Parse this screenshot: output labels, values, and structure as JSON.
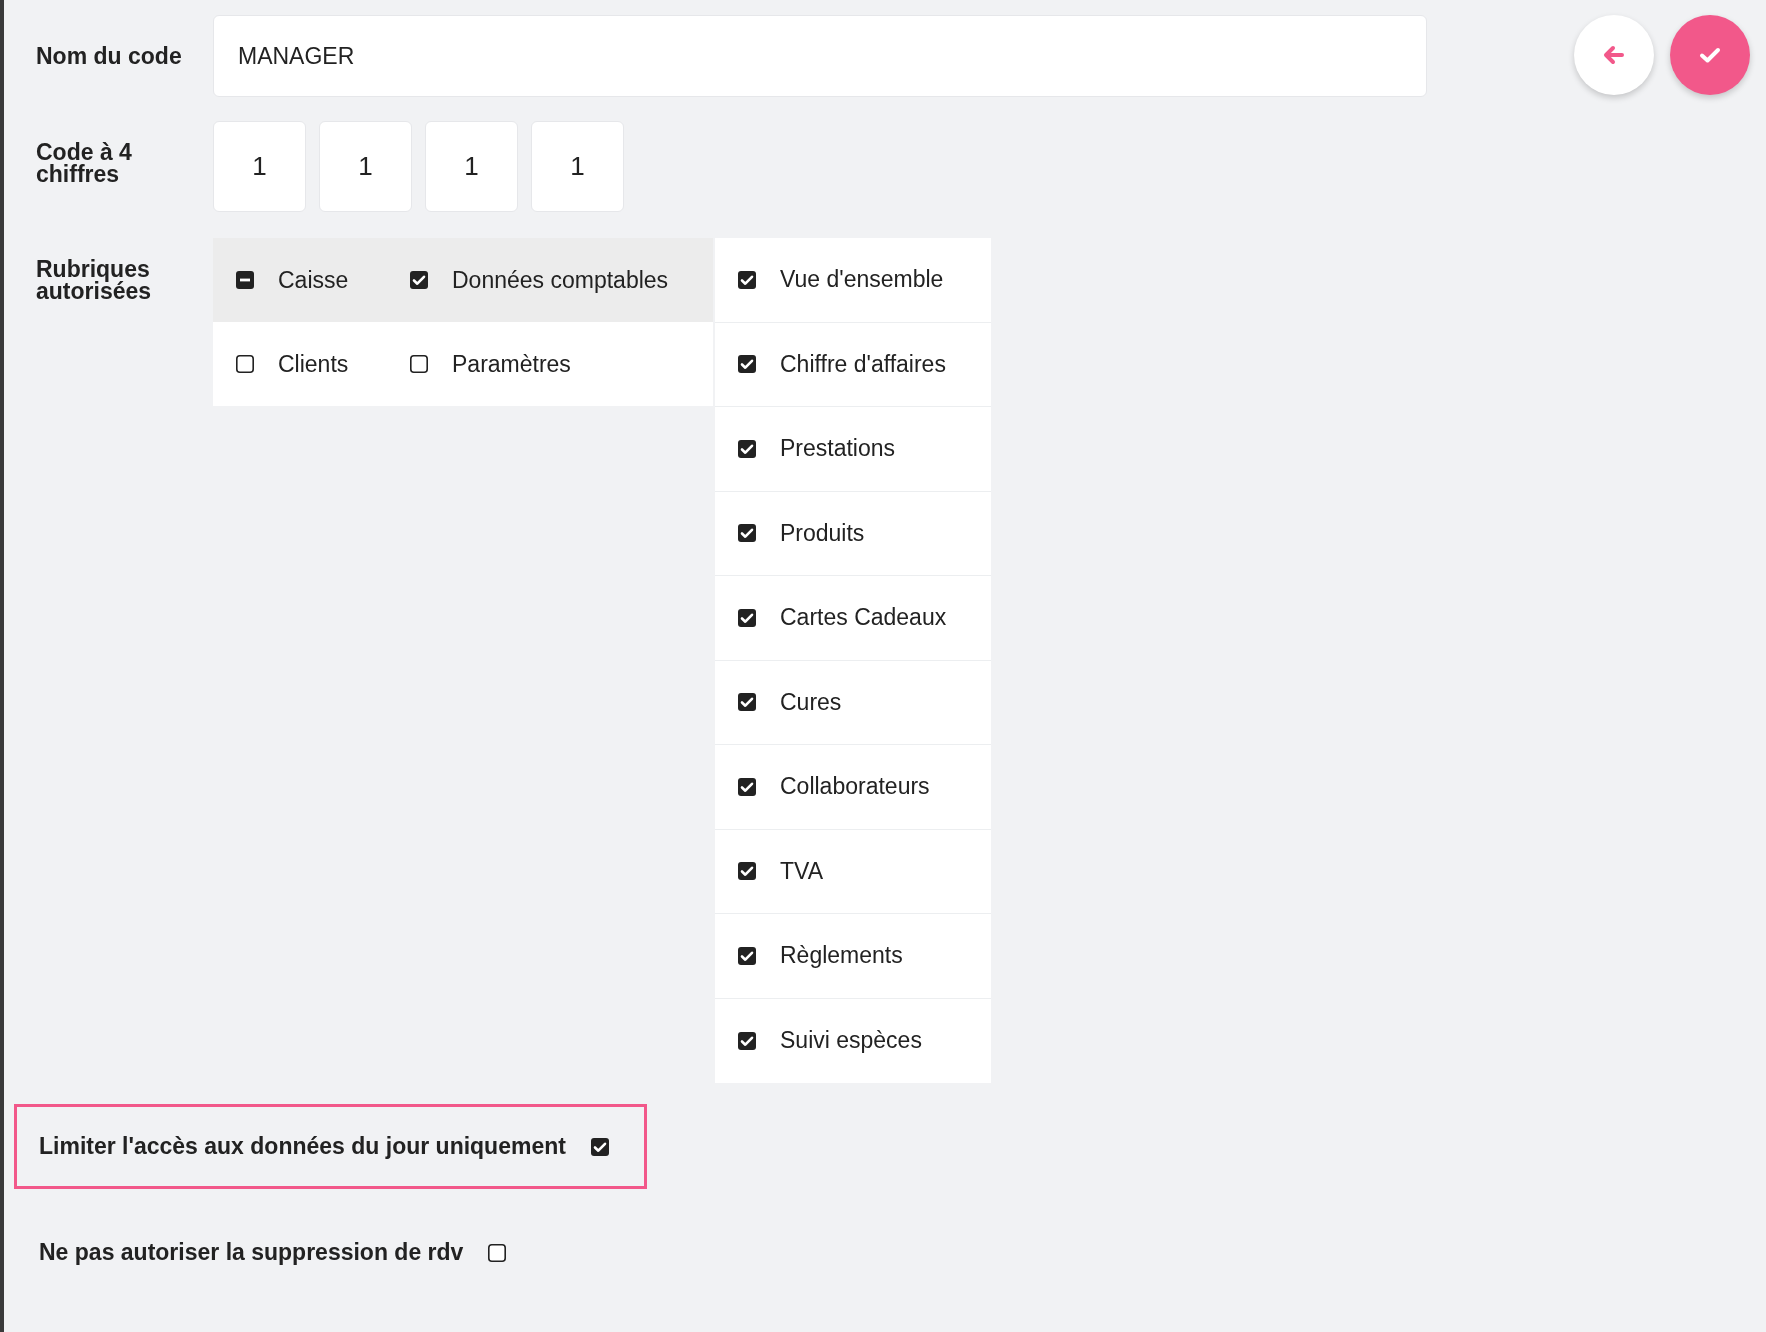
{
  "code_name": {
    "label": "Nom du code",
    "value": "MANAGER"
  },
  "pin": {
    "label": "Code à 4 chiffres",
    "digits": [
      "1",
      "1",
      "1",
      "1"
    ]
  },
  "sections": {
    "label": "Rubriques autorisées",
    "rows": [
      {
        "selected": true,
        "items": [
          {
            "label": "Caisse",
            "checked": true,
            "indeterminate": true
          },
          {
            "label": "Données comptables",
            "checked": true,
            "indeterminate": false
          }
        ]
      },
      {
        "selected": false,
        "items": [
          {
            "label": "Clients",
            "checked": false,
            "indeterminate": false
          },
          {
            "label": "Paramètres",
            "checked": false,
            "indeterminate": false
          }
        ]
      }
    ],
    "sub_items": [
      {
        "label": "Vue d'ensemble",
        "checked": true
      },
      {
        "label": "Chiffre d'affaires",
        "checked": true
      },
      {
        "label": "Prestations",
        "checked": true
      },
      {
        "label": "Produits",
        "checked": true
      },
      {
        "label": "Cartes Cadeaux",
        "checked": true
      },
      {
        "label": "Cures",
        "checked": true
      },
      {
        "label": "Collaborateurs",
        "checked": true
      },
      {
        "label": "TVA",
        "checked": true
      },
      {
        "label": "Règlements",
        "checked": true
      },
      {
        "label": "Suivi espèces",
        "checked": true
      }
    ]
  },
  "options": [
    {
      "label": "Limiter l'accès aux données du jour uniquement",
      "checked": true,
      "highlighted": true
    },
    {
      "label": "Ne pas autoriser la suppression de rdv",
      "checked": false,
      "highlighted": false
    }
  ]
}
